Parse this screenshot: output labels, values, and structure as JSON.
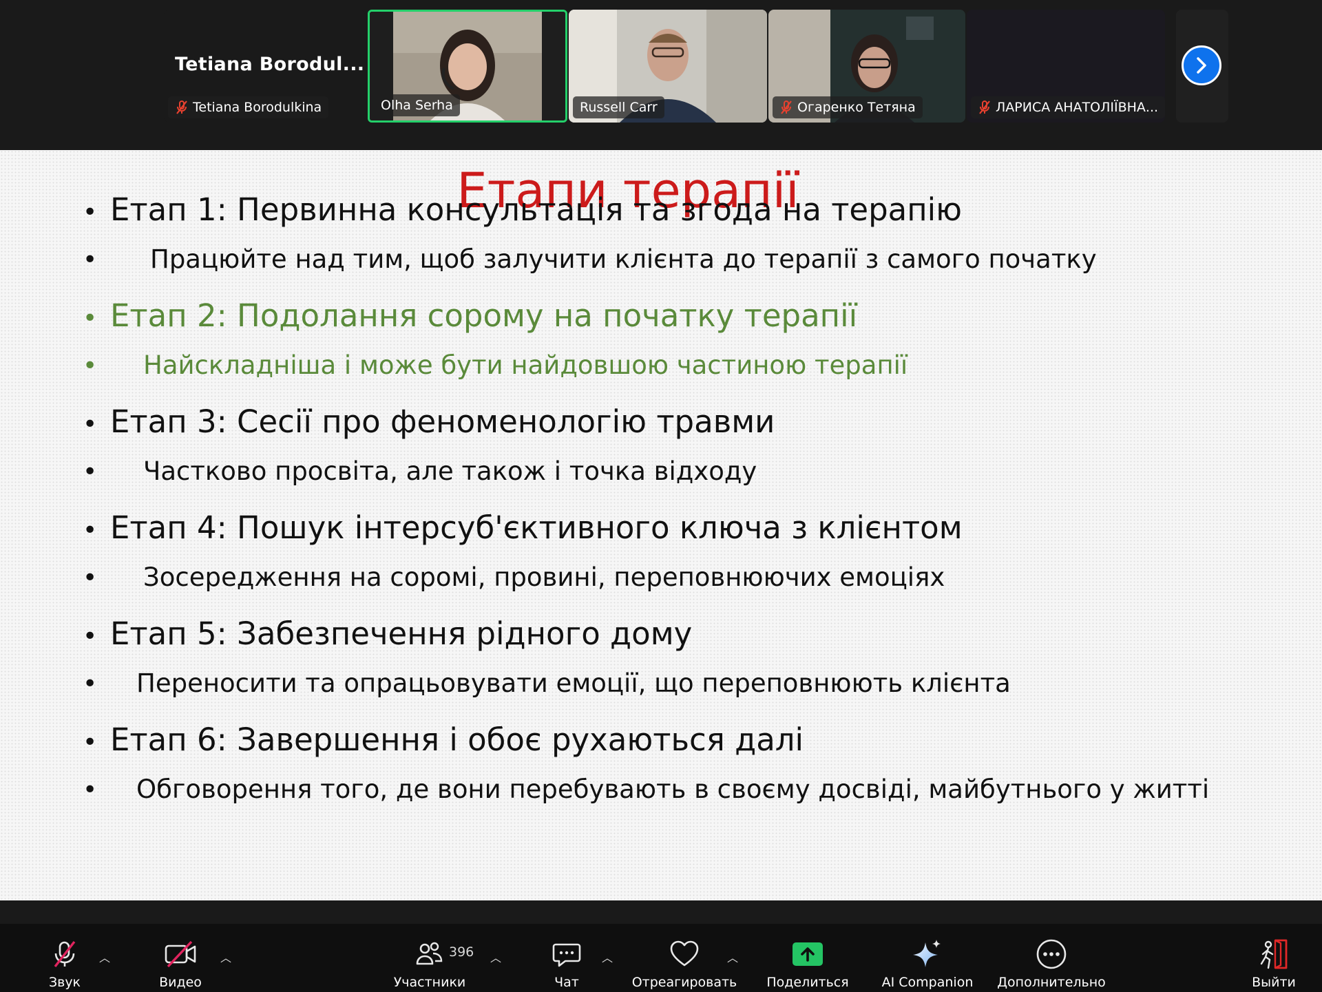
{
  "participants": {
    "active_speaker_name": "Tetiana  Borodul...",
    "tiles": [
      {
        "label": "Tetiana Borodulkina",
        "muted": true
      },
      {
        "label": "Olha Serha",
        "muted": false
      },
      {
        "label": "Russell Carr",
        "muted": false
      },
      {
        "label": "Огаренко Тетяна",
        "muted": true
      },
      {
        "label": "ЛАРИСА АНАТОЛІЇВНА...",
        "muted": true
      }
    ],
    "next_page_icon": "chevron-right-icon"
  },
  "slide": {
    "title": "Етапи терапії",
    "bullets": [
      {
        "level": 1,
        "text": "Етап 1: Первинна консультація та згода на терапію",
        "color": "#111111"
      },
      {
        "level": 2,
        "text": "Працюйте над тим, щоб залучити клієнта до терапії з самого початку",
        "color": "#111111"
      },
      {
        "level": 1,
        "text": "Етап 2: Подолання сорому на початку терапії",
        "color": "#5a8a3a"
      },
      {
        "level": 2,
        "text": "Найскладніша і може бути найдовшою частиною терапії",
        "color": "#5a8a3a"
      },
      {
        "level": 1,
        "text": "Етап 3: Сесії про феноменологію травми",
        "color": "#111111"
      },
      {
        "level": 2,
        "text": "Частково просвіта, але також і точка відходу",
        "color": "#111111"
      },
      {
        "level": 1,
        "text": "Етап 4: Пошук інтерсуб'єктивного ключа з клієнтом",
        "color": "#111111"
      },
      {
        "level": 2,
        "text": "Зосередження на соромі, провині, переповнюючих емоціях",
        "color": "#111111"
      },
      {
        "level": 1,
        "text": "Етап 5:  Забезпечення рідного дому",
        "color": "#111111"
      },
      {
        "level": 2,
        "text": "Переносити та опрацьовувати емоції, що переповнюють клієнта",
        "color": "#111111"
      },
      {
        "level": 1,
        "text": "Етап 6: Завершення і обоє рухаються далі",
        "color": "#111111"
      },
      {
        "level": 2,
        "text": "Обговорення того, де вони перебувають в своєму досвіді, майбутнього у житті",
        "color": "#111111"
      }
    ],
    "title_color": "#cc1b1b"
  },
  "toolbar": {
    "audio": {
      "label": "Звук",
      "icon": "microphone-muted-icon"
    },
    "video": {
      "label": "Видео",
      "icon": "camera-off-icon"
    },
    "participants": {
      "label": "Участники",
      "count": "396",
      "icon": "people-icon"
    },
    "chat": {
      "label": "Чат",
      "icon": "chat-icon"
    },
    "react": {
      "label": "Отреагировать",
      "icon": "heart-icon"
    },
    "share": {
      "label": "Поделиться",
      "icon": "share-screen-icon",
      "color": "#24c464"
    },
    "ai": {
      "label": "AI Companion",
      "icon": "sparkle-icon"
    },
    "more": {
      "label": "Дополнительно",
      "icon": "more-icon"
    },
    "leave": {
      "label": "Выйти",
      "icon": "leave-icon",
      "color": "#e02828"
    },
    "bullet_symbol": "•"
  }
}
